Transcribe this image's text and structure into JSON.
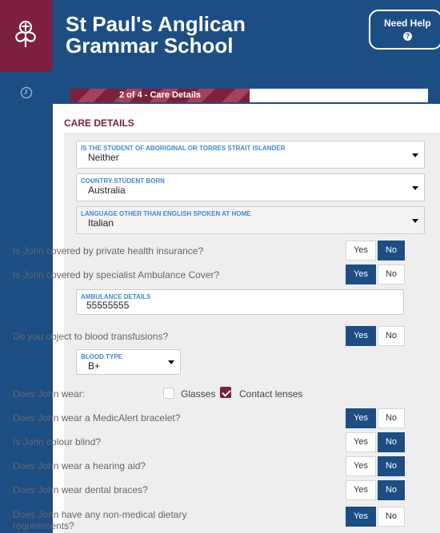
{
  "school": {
    "name_line1": "St Paul's Anglican",
    "name_line2": "Grammar School"
  },
  "help_button": {
    "label": "Need Help",
    "icon": "?"
  },
  "progress": {
    "label": "2 of 4 - Care Details",
    "step": 2,
    "total": 4
  },
  "section": {
    "title": "CARE DETAILS"
  },
  "fields": {
    "aboriginal": {
      "label": "IS THE STUDENT OF ABORIGINAL OR TORRES STRAIT ISLANDER",
      "value": "Neither"
    },
    "country_born": {
      "label": "COUNTRY STUDENT BORN",
      "value": "Australia"
    },
    "language": {
      "label": "LANGUAGE OTHER THAN ENGLISH SPOKEN AT HOME",
      "value": "Italian"
    },
    "ambulance_details": {
      "label": "AMBULANCE DETAILS",
      "value": "55555555"
    },
    "blood_type": {
      "label": "BLOOD TYPE",
      "value": "B+"
    }
  },
  "buttons": {
    "yes": "Yes",
    "no": "No"
  },
  "questions": {
    "health_insurance": {
      "text": "Is John covered by private health insurance?",
      "answer": "No"
    },
    "ambulance_cover": {
      "text": "Is John covered by specialist Ambulance Cover?",
      "answer": "Yes"
    },
    "blood_transfusions": {
      "text": "Do you object to blood transfusions?",
      "answer": "Yes"
    },
    "medicalert": {
      "text": "Does John wear a MedicAlert bracelet?",
      "answer": "Yes"
    },
    "colour_blind": {
      "text": "Is John colour blind?",
      "answer": "No"
    },
    "hearing_aid": {
      "text": "Does John wear a hearing aid?",
      "answer": "No"
    },
    "dental_braces": {
      "text": "Does John wear dental braces?",
      "answer": "No"
    },
    "dietary": {
      "text": "Does John have any non-medical dietary requirements?",
      "answer": "Yes"
    }
  },
  "wear": {
    "prompt": "Does John wear:",
    "glasses": {
      "label": "Glasses",
      "checked": false
    },
    "contacts": {
      "label": "Contact lenses",
      "checked": true
    }
  },
  "colors": {
    "primary": "#1c4e84",
    "accent": "#7d1f3f",
    "label_blue": "#3d8bd0"
  }
}
